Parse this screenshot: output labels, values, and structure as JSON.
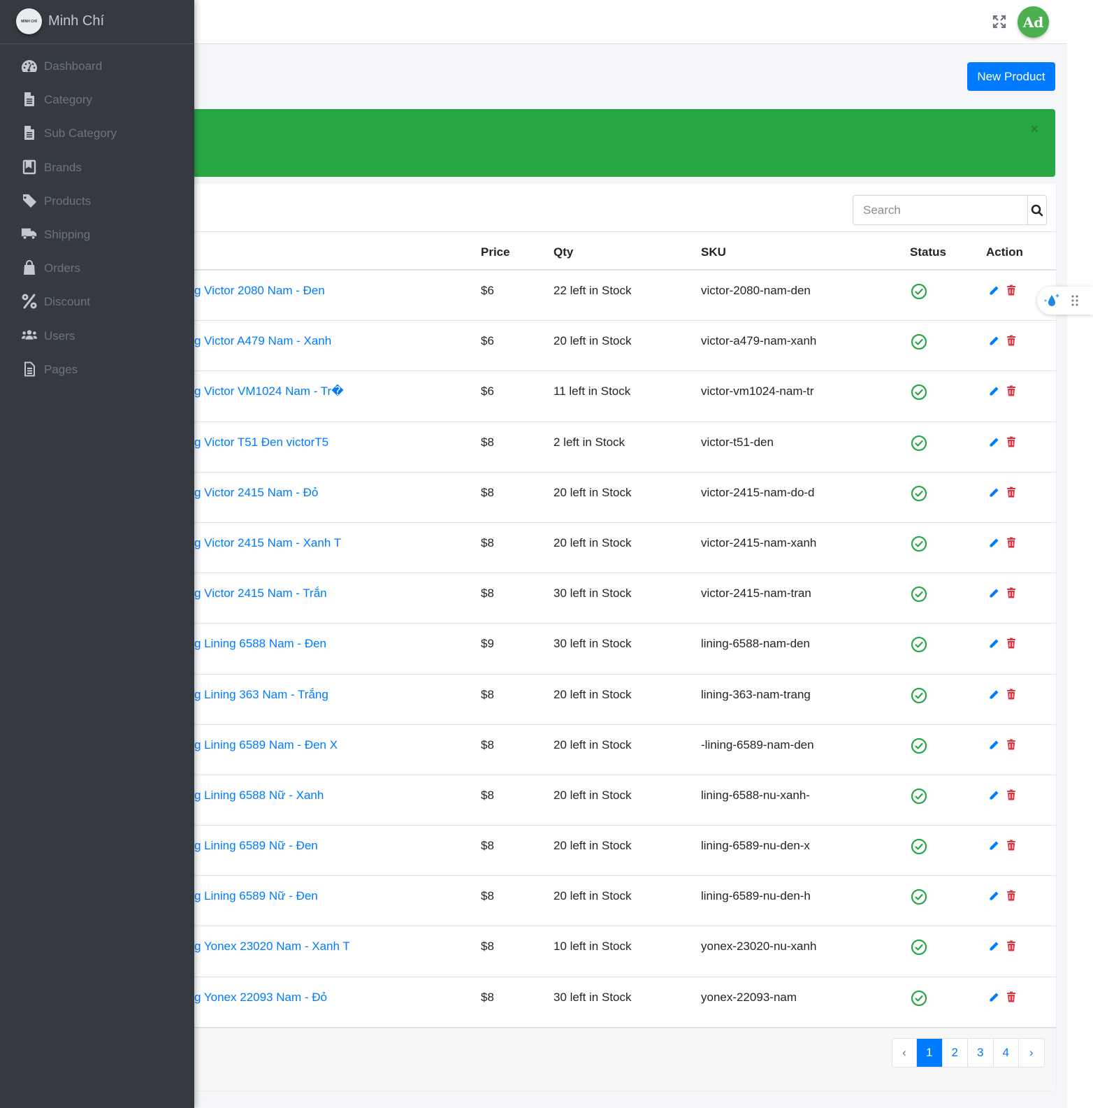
{
  "brand": {
    "logo_text": "MINH CHÍ",
    "title": "Minh Chí"
  },
  "sidebar": {
    "items": [
      {
        "label": "Dashboard",
        "icon": "dashboard-icon"
      },
      {
        "label": "Category",
        "icon": "file-icon"
      },
      {
        "label": "Sub Category",
        "icon": "file-icon"
      },
      {
        "label": "Brands",
        "icon": "book-icon"
      },
      {
        "label": "Products",
        "icon": "tag-icon"
      },
      {
        "label": "Shipping",
        "icon": "truck-icon"
      },
      {
        "label": "Orders",
        "icon": "shopping-bag-icon"
      },
      {
        "label": "Discount",
        "icon": "percent-icon"
      },
      {
        "label": "Users",
        "icon": "users-icon"
      },
      {
        "label": "Pages",
        "icon": "file-alt-icon"
      }
    ]
  },
  "header": {
    "avatar_text": "Ad"
  },
  "actions": {
    "new_product_label": "New Product"
  },
  "alert": {
    "close_label": "×",
    "color": "#28a745"
  },
  "search": {
    "placeholder": "Search"
  },
  "table": {
    "columns": {
      "price": "Price",
      "qty": "Qty",
      "sku": "SKU",
      "status": "Status",
      "action": "Action"
    },
    "rows": [
      {
        "name": "g Victor 2080 Nam - Đen",
        "price": "$6",
        "qty": "22 left in Stock",
        "sku": "victor-2080-nam-den"
      },
      {
        "name": "g Victor A479 Nam - Xanh",
        "price": "$6",
        "qty": "20 left in Stock",
        "sku": "victor-a479-nam-xanh"
      },
      {
        "name": "g Victor VM1024 Nam - Tr�",
        "price": "$6",
        "qty": "11 left in Stock",
        "sku": "victor-vm1024-nam-tr"
      },
      {
        "name": "g Victor T51 Đen victorT5",
        "price": "$8",
        "qty": "2 left in Stock",
        "sku": "victor-t51-den"
      },
      {
        "name": "g Victor 2415 Nam - Đỏ",
        "price": "$8",
        "qty": "20 left in Stock",
        "sku": "victor-2415-nam-do-d"
      },
      {
        "name": "g Victor 2415 Nam - Xanh T",
        "price": "$8",
        "qty": "20 left in Stock",
        "sku": "victor-2415-nam-xanh"
      },
      {
        "name": "g Victor 2415 Nam - Trắn",
        "price": "$8",
        "qty": "30 left in Stock",
        "sku": "victor-2415-nam-tran"
      },
      {
        "name": "g Lining 6588 Nam - Đen",
        "price": "$9",
        "qty": "30 left in Stock",
        "sku": "lining-6588-nam-den"
      },
      {
        "name": "g Lining 363 Nam - Trắng",
        "price": "$8",
        "qty": "20 left in Stock",
        "sku": "lining-363-nam-trang"
      },
      {
        "name": "g Lining 6589 Nam - Đen X",
        "price": "$8",
        "qty": "20 left in Stock",
        "sku": "-lining-6589-nam-den"
      },
      {
        "name": "g Lining 6588 Nữ - Xanh",
        "price": "$8",
        "qty": "20 left in Stock",
        "sku": "lining-6588-nu-xanh-"
      },
      {
        "name": "g Lining 6589 Nữ - Đen",
        "price": "$8",
        "qty": "20 left in Stock",
        "sku": "lining-6589-nu-den-x"
      },
      {
        "name": "g Lining 6589 Nữ - Đen",
        "price": "$8",
        "qty": "20 left in Stock",
        "sku": "lining-6589-nu-den-h"
      },
      {
        "name": "g Yonex 23020 Nam - Xanh T",
        "price": "$8",
        "qty": "10 left in Stock",
        "sku": "yonex-23020-nu-xanh"
      },
      {
        "name": "g Yonex 22093 Nam - Đỏ",
        "price": "$8",
        "qty": "30 left in Stock",
        "sku": "yonex-22093-nam"
      }
    ]
  },
  "pagination": {
    "prev": "‹",
    "pages": [
      "1",
      "2",
      "3",
      "4"
    ],
    "next": "›",
    "active": "1"
  },
  "colors": {
    "primary": "#007bff",
    "success": "#28a745",
    "danger": "#dc3545",
    "sidebar": "#343a40"
  }
}
